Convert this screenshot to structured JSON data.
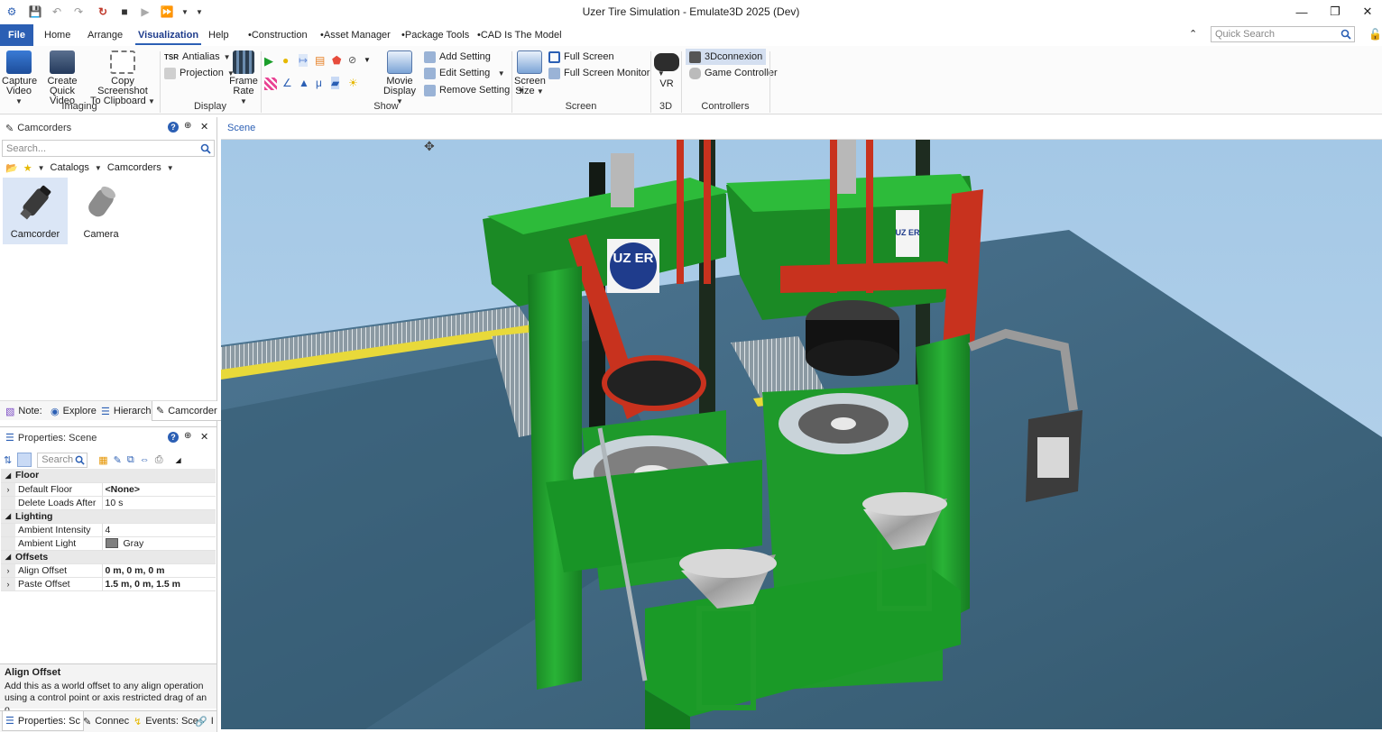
{
  "window": {
    "title": "Uzer Tire Simulation - Emulate3D 2025 (Dev)"
  },
  "ribbon_tabs": [
    "File",
    "Home",
    "Arrange",
    "Visualization",
    "Help",
    "Construction",
    "Asset Manager",
    "Package Tools",
    "CAD Is The Model"
  ],
  "quick_search": {
    "placeholder": "Quick Search"
  },
  "ribbon": {
    "imaging": {
      "label": "Imaging",
      "capture": [
        "Capture",
        "Video"
      ],
      "quick": [
        "Create",
        "Quick Video"
      ],
      "copy": [
        "Copy Screenshot",
        "To Clipboard"
      ]
    },
    "display": {
      "label": "Display",
      "antialias": "Antialias",
      "projection": "Projection",
      "tsr": "TSR",
      "frame": [
        "Frame",
        "Rate"
      ]
    },
    "show": {
      "label": "Show",
      "movie": [
        "Movie",
        "Display"
      ],
      "add": "Add Setting",
      "edit": "Edit Setting",
      "remove": "Remove Setting"
    },
    "screen": {
      "label": "Screen",
      "size": [
        "Screen",
        "Size"
      ],
      "full": "Full Screen",
      "monitor": "Full Screen Monitor"
    },
    "three_d": {
      "label": "3D",
      "vr": "VR"
    },
    "controllers": {
      "label": "Controllers",
      "connexion": "3Dconnexion",
      "game": "Game Controller"
    }
  },
  "camcorders_panel": {
    "title": "Camcorders",
    "search_placeholder": "Search...",
    "breadcrumb": [
      "Catalogs",
      "Camcorders"
    ],
    "items": [
      "Camcorder",
      "Camera"
    ],
    "tabs": [
      "Note:",
      "Explore",
      "Hierarch",
      "Camcorder"
    ]
  },
  "properties_panel": {
    "title": "Properties: Scene",
    "search_placeholder": "Search",
    "rows": [
      {
        "type": "cat",
        "name": "Floor"
      },
      {
        "type": "prop",
        "name": "Default Floor",
        "value": "<None>",
        "bold": true,
        "expand": true
      },
      {
        "type": "prop",
        "name": "Delete Loads After",
        "value": "10 s"
      },
      {
        "type": "cat",
        "name": "Lighting"
      },
      {
        "type": "prop",
        "name": "Ambient Intensity",
        "value": "4"
      },
      {
        "type": "prop",
        "name": "Ambient Light",
        "value": "Gray",
        "swatch": "#808080"
      },
      {
        "type": "cat",
        "name": "Offsets"
      },
      {
        "type": "prop",
        "name": "Align Offset",
        "value": "0 m, 0 m, 0 m",
        "bold": true,
        "expand": true
      },
      {
        "type": "prop",
        "name": "Paste Offset",
        "value": "1.5 m, 0 m, 1.5 m",
        "bold": true,
        "expand": true
      }
    ],
    "description_title": "Align Offset",
    "description_text": "Add this as a world offset to any align operation using a control point or axis restricted drag of an o...",
    "tabs": [
      "Properties: Sc",
      "Connec",
      "Events: Sce",
      "I"
    ]
  },
  "scene": {
    "tab": "Scene",
    "logo": "UZ ER",
    "logo2": "UZ ER"
  },
  "colors": {
    "accent": "#2b5fb4",
    "machine_green": "#1f9c2a",
    "frame_red": "#c8321e",
    "sky": "#a9cbe6",
    "floor": "#3e6580"
  }
}
